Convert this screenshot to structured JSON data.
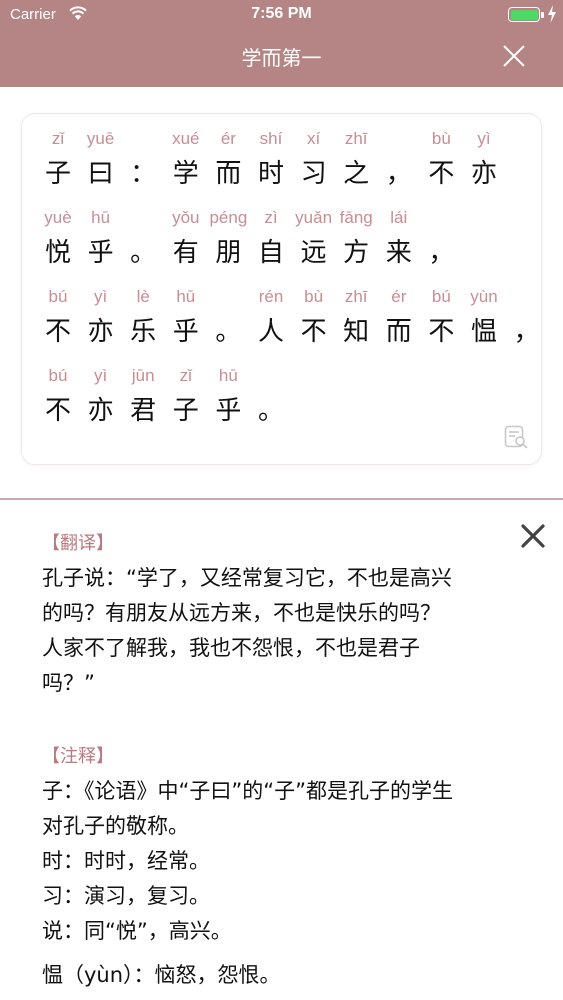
{
  "status_bar": {
    "carrier": "Carrier",
    "time": "7:56 PM",
    "battery_level": 1.0
  },
  "nav": {
    "title": "学而第一"
  },
  "passage": {
    "lines": [
      [
        {
          "py": "zǐ",
          "hz": "子"
        },
        {
          "py": "yuē",
          "hz": "曰"
        },
        {
          "py": "",
          "hz": "："
        },
        {
          "py": "xué",
          "hz": "学"
        },
        {
          "py": "ér",
          "hz": "而"
        },
        {
          "py": "shí",
          "hz": "时"
        },
        {
          "py": "xí",
          "hz": "习"
        },
        {
          "py": "zhī",
          "hz": "之"
        },
        {
          "py": "",
          "hz": "，"
        },
        {
          "py": "bù",
          "hz": "不"
        },
        {
          "py": "yì",
          "hz": "亦"
        }
      ],
      [
        {
          "py": "yuè",
          "hz": "悦"
        },
        {
          "py": "hū",
          "hz": "乎"
        },
        {
          "py": "",
          "hz": "。"
        },
        {
          "py": "yǒu",
          "hz": "有"
        },
        {
          "py": "péng",
          "hz": "朋"
        },
        {
          "py": "zì",
          "hz": "自"
        },
        {
          "py": "yuǎn",
          "hz": "远"
        },
        {
          "py": "fāng",
          "hz": "方"
        },
        {
          "py": "lái",
          "hz": "来"
        },
        {
          "py": "",
          "hz": "，"
        }
      ],
      [
        {
          "py": "bú",
          "hz": "不"
        },
        {
          "py": "yì",
          "hz": "亦"
        },
        {
          "py": "lè",
          "hz": "乐"
        },
        {
          "py": "hū",
          "hz": "乎"
        },
        {
          "py": "",
          "hz": "。"
        },
        {
          "py": "rén",
          "hz": "人"
        },
        {
          "py": "bù",
          "hz": "不"
        },
        {
          "py": "zhī",
          "hz": "知"
        },
        {
          "py": "ér",
          "hz": "而"
        },
        {
          "py": "bú",
          "hz": "不"
        },
        {
          "py": "yùn",
          "hz": "愠"
        },
        {
          "py": "",
          "hz": "，"
        }
      ],
      [
        {
          "py": "bú",
          "hz": "不"
        },
        {
          "py": "yì",
          "hz": "亦"
        },
        {
          "py": "jūn",
          "hz": "君"
        },
        {
          "py": "zǐ",
          "hz": "子"
        },
        {
          "py": "hū",
          "hz": "乎"
        },
        {
          "py": "",
          "hz": "。"
        }
      ]
    ]
  },
  "translation": {
    "heading": "【翻译】",
    "lines": [
      "孔子说：“学了，又经常复习它，不也是高兴",
      "的吗？有朋友从远方来，不也是快乐的吗？",
      "人家不了解我，我也不怨恨，不也是君子",
      "吗？”"
    ]
  },
  "notes": {
    "heading": "【注释】",
    "lines": [
      "子：《论语》中“子曰”的“子”都是孔子的学生",
      "对孔子的敬称。",
      "时：时时，经常。",
      "习：演习，复习。",
      "说：同“悦”，高兴。",
      "愠（yùn）：恼怒，怨恨。"
    ]
  },
  "colors": {
    "nav_bg": "#b58585",
    "pinyin": "#c98d94",
    "section_heading": "#b97a7f",
    "battery": "#4cd964"
  }
}
